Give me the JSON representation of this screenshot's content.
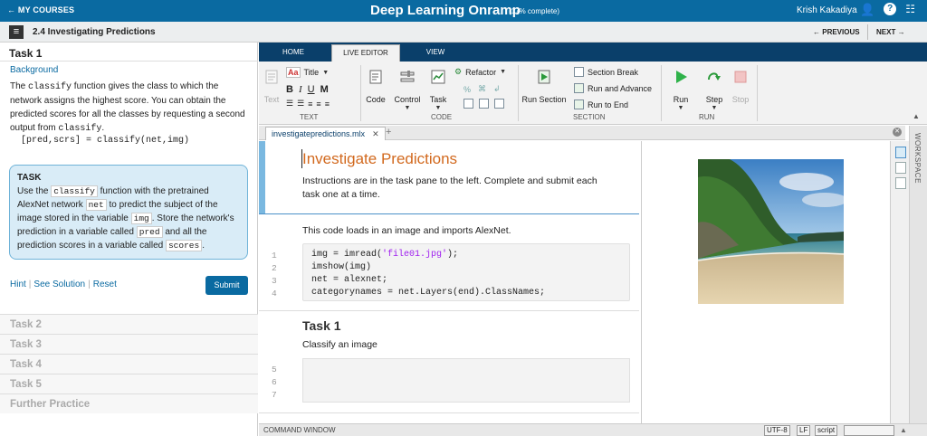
{
  "topbar": {
    "back_label": "MY COURSES",
    "title": "Deep Learning Onramp",
    "progress": "(17% complete)",
    "user": "Krish Kakadiya"
  },
  "lesson": {
    "title": "2.4 Investigating Predictions",
    "previous": "PREVIOUS",
    "next": "NEXT"
  },
  "task_pane": {
    "heading": "Task 1",
    "background_label": "Background",
    "bg_p1": "The ",
    "bg_code1": "classify",
    "bg_p2": " function gives the class to which the network assigns the highest score. You can obtain the predicted scores for all the classes by requesting a second output from ",
    "bg_code2": "classify",
    "bg_p3": ".",
    "code_example": "[pred,scrs] = classify(net,img)",
    "task_box": {
      "heading": "TASK",
      "t1": "Use the ",
      "k1": "classify",
      "t2": " function with the pretrained AlexNet network ",
      "k2": "net",
      "t3": " to predict the subject of the image stored in the variable ",
      "k3": "img",
      "t4": ". Store the network's prediction in a variable called ",
      "k4": "pred",
      "t5": " and all the prediction scores in a variable called ",
      "k5": "scores",
      "t6": "."
    },
    "hint": "Hint",
    "see_solution": "See Solution",
    "reset": "Reset",
    "submit": "Submit",
    "tasks": [
      "Task 2",
      "Task 3",
      "Task 4",
      "Task 5",
      "Further Practice"
    ]
  },
  "ribbon": {
    "tabs": [
      "HOME",
      "LIVE EDITOR",
      "VIEW"
    ],
    "text_group": {
      "text": "Text",
      "title": "Title",
      "bold": "B",
      "italic": "I",
      "underline": "U",
      "mono": "M",
      "label": "TEXT"
    },
    "code_group": {
      "code": "Code",
      "control": "Control",
      "task": "Task",
      "refactor": "Refactor",
      "label": "CODE"
    },
    "section_group": {
      "run_section": "Run Section",
      "section_break": "Section Break",
      "run_and_advance": "Run and Advance",
      "run_to_end": "Run to End",
      "label": "SECTION"
    },
    "run_group": {
      "run": "Run",
      "step": "Step",
      "stop": "Stop",
      "label": "RUN"
    }
  },
  "editor": {
    "file_tab": "investigatepredictions.mlx",
    "heading": "Investigate Predictions",
    "intro": "Instructions are in the task pane to the left. Complete and submit each task one at a time.",
    "code_intro": "This code loads in an image and imports AlexNet.",
    "code_lines": [
      {
        "num": "1",
        "pre": "img = imread(",
        "str": "'file01.jpg'",
        "post": ");"
      },
      {
        "num": "2",
        "pre": "imshow(img)",
        "str": "",
        "post": ""
      },
      {
        "num": "3",
        "pre": "net = alexnet;",
        "str": "",
        "post": ""
      },
      {
        "num": "4",
        "pre": "categorynames = net.Layers(end).ClassNames;",
        "str": "",
        "post": ""
      }
    ],
    "task1_heading": "Task 1",
    "task1_text": "Classify an image",
    "empty_lines": [
      "5",
      "6",
      "7"
    ]
  },
  "workspace_label": "WORKSPACE",
  "status": {
    "command_window": "COMMAND WINDOW",
    "encoding": "UTF-8",
    "line_ending": "LF",
    "type": "script"
  },
  "colors": {
    "brand": "#0a6aa1",
    "ribbon_tabs": "#0a3f6a",
    "heading_orange": "#d2691e",
    "string_purple": "#a020f0"
  }
}
